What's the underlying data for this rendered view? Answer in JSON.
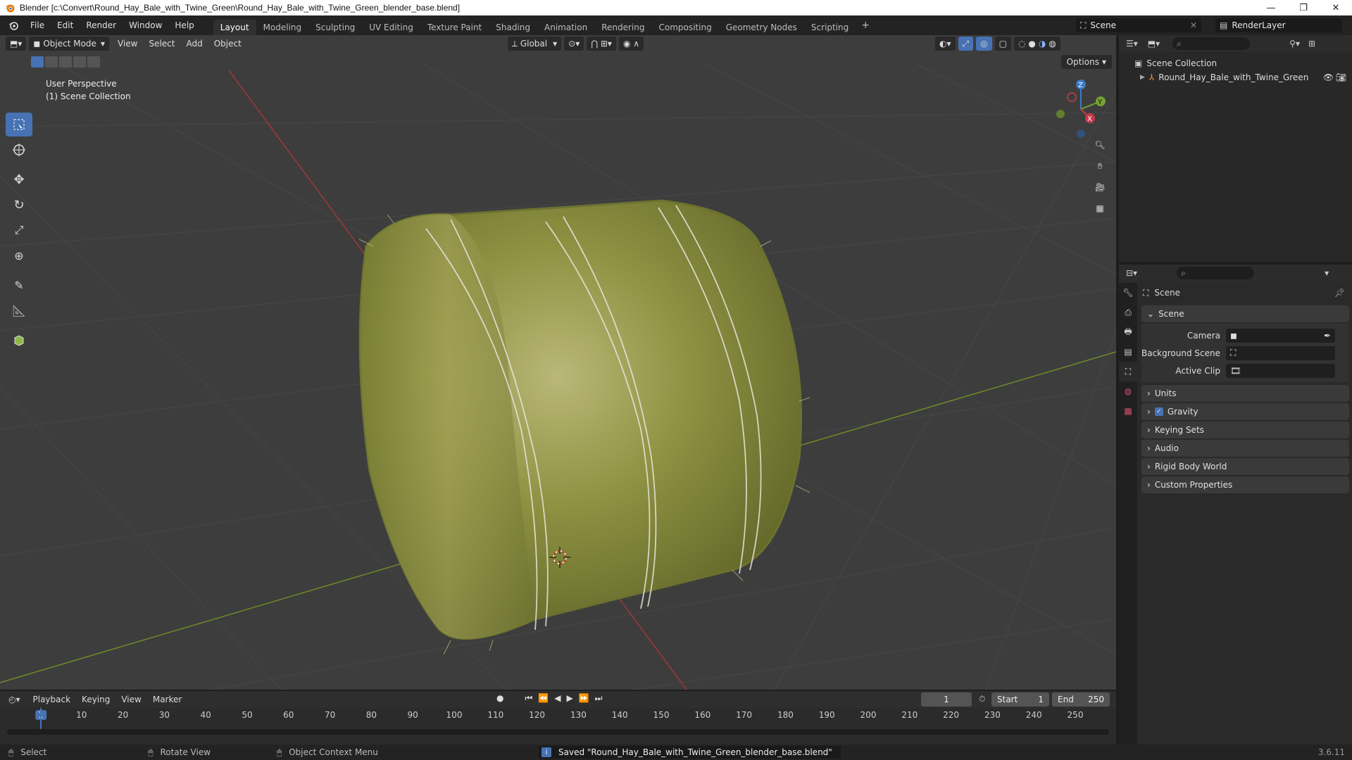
{
  "window": {
    "title": "Blender [c:\\Convert\\Round_Hay_Bale_with_Twine_Green\\Round_Hay_Bale_with_Twine_Green_blender_base.blend]",
    "controls": [
      "—",
      "❐",
      "✕"
    ]
  },
  "menu": [
    "File",
    "Edit",
    "Render",
    "Window",
    "Help"
  ],
  "workspaces": [
    "Layout",
    "Modeling",
    "Sculpting",
    "UV Editing",
    "Texture Paint",
    "Shading",
    "Animation",
    "Rendering",
    "Compositing",
    "Geometry Nodes",
    "Scripting"
  ],
  "workspace_add": "+",
  "scene_name": "Scene",
  "view_layer": "RenderLayer",
  "viewport": {
    "mode": "Object Mode",
    "menus": [
      "View",
      "Select",
      "Add",
      "Object"
    ],
    "transform_orientation": "Global",
    "options_label": "Options",
    "info_line1": "User Perspective",
    "info_line2": "(1) Scene Collection",
    "gizmo_axes": {
      "x": "X",
      "y": "Y",
      "z": "Z"
    }
  },
  "toolbar": [
    "select-box",
    "cursor",
    "move",
    "rotate",
    "scale",
    "transform",
    "annotate",
    "measure",
    "add-cube"
  ],
  "outliner": {
    "collection": "Scene Collection",
    "object": "Round_Hay_Bale_with_Twine_Green"
  },
  "properties": {
    "context_title": "Scene",
    "section_scene": "Scene",
    "camera_label": "Camera",
    "background_scene_label": "Background Scene",
    "active_clip_label": "Active Clip",
    "panels": [
      "Units",
      "Gravity",
      "Keying Sets",
      "Audio",
      "Rigid Body World",
      "Custom Properties"
    ]
  },
  "timeline": {
    "menus": [
      "Playback",
      "Keying",
      "View",
      "Marker"
    ],
    "current_frame": "1",
    "start_label": "Start",
    "start_value": "1",
    "end_label": "End",
    "end_value": "250",
    "ruler_ticks": [
      "1",
      "10",
      "20",
      "30",
      "40",
      "50",
      "60",
      "70",
      "80",
      "90",
      "100",
      "110",
      "120",
      "130",
      "140",
      "150",
      "160",
      "170",
      "180",
      "190",
      "200",
      "210",
      "220",
      "230",
      "240",
      "250"
    ]
  },
  "statusbar": {
    "select": "Select",
    "rotate_view": "Rotate View",
    "context_menu": "Object Context Menu",
    "saved_message": "Saved \"Round_Hay_Bale_with_Twine_Green_blender_base.blend\"",
    "version": "3.6.11"
  }
}
